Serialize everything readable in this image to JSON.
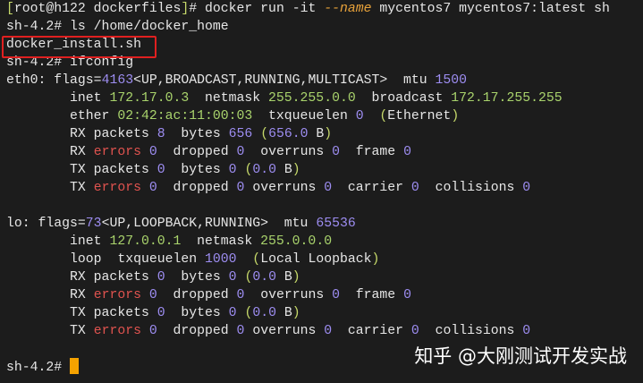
{
  "colors": {
    "background": "#1c1c1c",
    "text": "#e6e6e6",
    "number": "#9d8df1",
    "address": "#a9d36c",
    "error": "#e0534f",
    "option": "#e8a23a",
    "highlight_box": "#e02020",
    "cursor": "#f5a200"
  },
  "lines": [
    [
      [
        "[",
        "y"
      ],
      [
        "root@h122 dockerfiles",
        ""
      ],
      [
        "]",
        "y"
      ],
      [
        "# docker run -it ",
        ""
      ],
      [
        "--name",
        "o"
      ],
      [
        " mycentos7 mycentos7:latest sh",
        ""
      ]
    ],
    [
      [
        "sh-4.2# ls /home/docker_home",
        ""
      ]
    ],
    [
      [
        "docker_install.sh",
        ""
      ]
    ],
    [
      [
        "sh-4.2# ifconfig",
        ""
      ]
    ],
    [
      [
        "eth0: flags=",
        ""
      ],
      [
        "4163",
        "p"
      ],
      [
        "<UP,BROADCAST,RUNNING,MULTICAST>  mtu ",
        ""
      ],
      [
        "1500",
        "p"
      ]
    ],
    [
      [
        "        inet ",
        ""
      ],
      [
        "172.17.0.3",
        "g"
      ],
      [
        "  netmask ",
        ""
      ],
      [
        "255.255.0.0",
        "g"
      ],
      [
        "  broadcast ",
        ""
      ],
      [
        "172.17.255.255",
        "g"
      ]
    ],
    [
      [
        "        ether ",
        ""
      ],
      [
        "02:42:ac:11:00:03",
        "g"
      ],
      [
        "  txqueuelen ",
        ""
      ],
      [
        "0",
        "p"
      ],
      [
        "  ",
        ""
      ],
      [
        "(",
        "y"
      ],
      [
        "Ethernet",
        ""
      ],
      [
        ")",
        "y"
      ]
    ],
    [
      [
        "        RX packets ",
        ""
      ],
      [
        "8",
        "p"
      ],
      [
        "  bytes ",
        ""
      ],
      [
        "656",
        "p"
      ],
      [
        " ",
        ""
      ],
      [
        "(",
        "y"
      ],
      [
        "656.0",
        "p"
      ],
      [
        " B",
        ""
      ],
      [
        ")",
        "y"
      ]
    ],
    [
      [
        "        RX ",
        ""
      ],
      [
        "errors",
        "r"
      ],
      [
        " ",
        ""
      ],
      [
        "0",
        "p"
      ],
      [
        "  dropped ",
        ""
      ],
      [
        "0",
        "p"
      ],
      [
        "  overruns ",
        ""
      ],
      [
        "0",
        "p"
      ],
      [
        "  frame ",
        ""
      ],
      [
        "0",
        "p"
      ]
    ],
    [
      [
        "        TX packets ",
        ""
      ],
      [
        "0",
        "p"
      ],
      [
        "  bytes ",
        ""
      ],
      [
        "0",
        "p"
      ],
      [
        " ",
        ""
      ],
      [
        "(",
        "y"
      ],
      [
        "0.0",
        "p"
      ],
      [
        " B",
        ""
      ],
      [
        ")",
        "y"
      ]
    ],
    [
      [
        "        TX ",
        ""
      ],
      [
        "errors",
        "r"
      ],
      [
        " ",
        ""
      ],
      [
        "0",
        "p"
      ],
      [
        "  dropped ",
        ""
      ],
      [
        "0",
        "p"
      ],
      [
        " overruns ",
        ""
      ],
      [
        "0",
        "p"
      ],
      [
        "  carrier ",
        ""
      ],
      [
        "0",
        "p"
      ],
      [
        "  collisions ",
        ""
      ],
      [
        "0",
        "p"
      ]
    ],
    [],
    [
      [
        "lo: flags=",
        ""
      ],
      [
        "73",
        "p"
      ],
      [
        "<UP,LOOPBACK,RUNNING>  mtu ",
        ""
      ],
      [
        "65536",
        "p"
      ]
    ],
    [
      [
        "        inet ",
        ""
      ],
      [
        "127.0.0.1",
        "g"
      ],
      [
        "  netmask ",
        ""
      ],
      [
        "255.0.0.0",
        "g"
      ]
    ],
    [
      [
        "        loop  txqueuelen ",
        ""
      ],
      [
        "1000",
        "p"
      ],
      [
        "  ",
        ""
      ],
      [
        "(",
        "y"
      ],
      [
        "Local Loopback",
        ""
      ],
      [
        ")",
        "y"
      ]
    ],
    [
      [
        "        RX packets ",
        ""
      ],
      [
        "0",
        "p"
      ],
      [
        "  bytes ",
        ""
      ],
      [
        "0",
        "p"
      ],
      [
        " ",
        ""
      ],
      [
        "(",
        "y"
      ],
      [
        "0.0",
        "p"
      ],
      [
        " B",
        ""
      ],
      [
        ")",
        "y"
      ]
    ],
    [
      [
        "        RX ",
        ""
      ],
      [
        "errors",
        "r"
      ],
      [
        " ",
        ""
      ],
      [
        "0",
        "p"
      ],
      [
        "  dropped ",
        ""
      ],
      [
        "0",
        "p"
      ],
      [
        "  overruns ",
        ""
      ],
      [
        "0",
        "p"
      ],
      [
        "  frame ",
        ""
      ],
      [
        "0",
        "p"
      ]
    ],
    [
      [
        "        TX packets ",
        ""
      ],
      [
        "0",
        "p"
      ],
      [
        "  bytes ",
        ""
      ],
      [
        "0",
        "p"
      ],
      [
        " ",
        ""
      ],
      [
        "(",
        "y"
      ],
      [
        "0.0",
        "p"
      ],
      [
        " B",
        ""
      ],
      [
        ")",
        "y"
      ]
    ],
    [
      [
        "        TX ",
        ""
      ],
      [
        "errors",
        "r"
      ],
      [
        " ",
        ""
      ],
      [
        "0",
        "p"
      ],
      [
        "  dropped ",
        ""
      ],
      [
        "0",
        "p"
      ],
      [
        " overruns ",
        ""
      ],
      [
        "0",
        "p"
      ],
      [
        "  carrier ",
        ""
      ],
      [
        "0",
        "p"
      ],
      [
        "  collisions ",
        ""
      ],
      [
        "0",
        "p"
      ]
    ],
    [],
    [
      [
        "sh-4.2# ",
        ""
      ]
    ]
  ],
  "watermark": "知乎 @大刚测试开发实战"
}
